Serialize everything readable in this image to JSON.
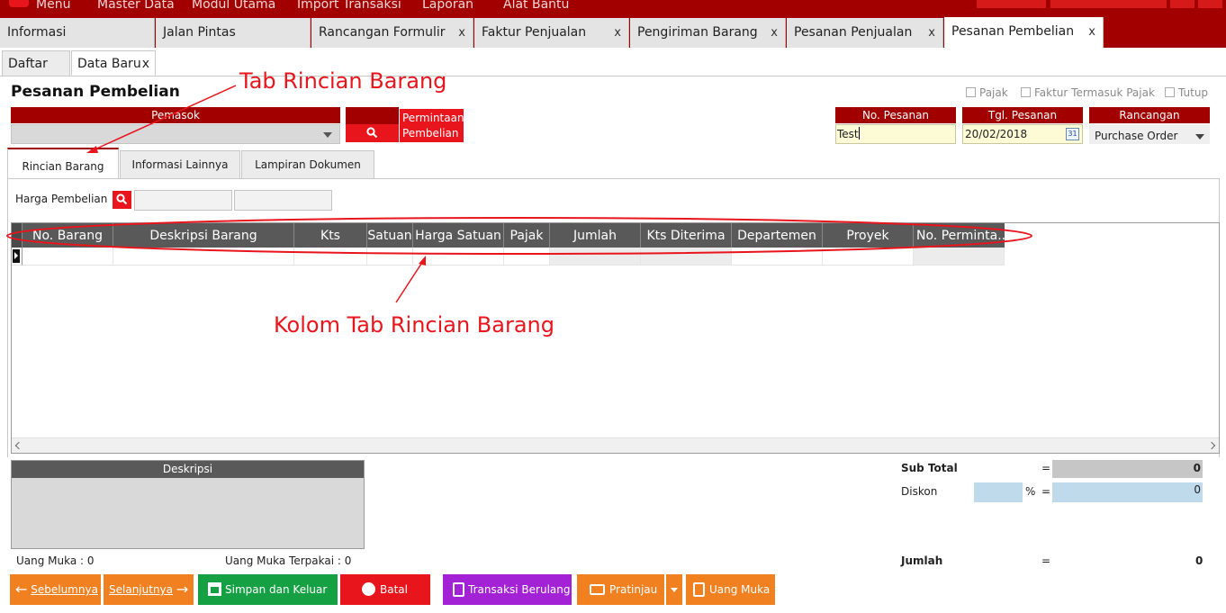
{
  "menu": {
    "items": [
      "Menu",
      "Master Data",
      "Modul Utama",
      "Import Transaksi",
      "Laporan",
      "Alat Bantu"
    ]
  },
  "module_tabs": [
    {
      "label": "Informasi",
      "closable": false
    },
    {
      "label": "Jalan Pintas",
      "closable": false
    },
    {
      "label": "Rancangan Formulir",
      "closable": true
    },
    {
      "label": "Faktur Penjualan",
      "closable": true
    },
    {
      "label": "Pengiriman Barang",
      "closable": true
    },
    {
      "label": "Pesanan Penjualan",
      "closable": true
    },
    {
      "label": "Pesanan Pembelian",
      "closable": true
    }
  ],
  "close_glyph": "x",
  "sub_tabs": {
    "list": "Daftar",
    "new": "Data Baru"
  },
  "form": {
    "title": "Pesanan Pembelian",
    "checkboxes": {
      "pajak": "Pajak",
      "faktur": "Faktur Termasuk Pajak",
      "tutup": "Tutup"
    },
    "pemasok_label": "Pemasok",
    "permintaan_label_1": "Permintaan",
    "permintaan_label_2": "Pembelian",
    "no_pesanan_label": "No. Pesanan",
    "no_pesanan_value": "Test",
    "tgl_pesanan_label": "Tgl. Pesanan",
    "tgl_pesanan_value": "20/02/2018",
    "calendar_day": "31",
    "rancangan_label": "Rancangan",
    "rancangan_value": "Purchase Order"
  },
  "inner_tabs": [
    "Rincian Barang",
    "Informasi Lainnya",
    "Lampiran Dokumen"
  ],
  "harga_pembelian_label": "Harga Pembelian",
  "grid": {
    "columns": [
      "No. Barang",
      "Deskripsi Barang",
      "Kts",
      "Satuan",
      "Harga Satuan",
      "Pajak",
      "Jumlah",
      "Kts Diterima",
      "Departemen",
      "Proyek",
      "No. Perminta..."
    ]
  },
  "annotations": {
    "tab_label": "Tab Rincian Barang",
    "column_label": "Kolom Tab Rincian Barang",
    "color": "#e8151d"
  },
  "deskripsi_label": "Deskripsi",
  "totals": {
    "subtotal_label": "Sub Total",
    "subtotal_value": "0",
    "diskon_label": "Diskon",
    "diskon_value": "0",
    "percent": "%",
    "equals": "=",
    "jumlah_label": "Jumlah",
    "jumlah_value": "0"
  },
  "uang_muka": "Uang Muka : 0",
  "uang_muka_terpakai": "Uang Muka Terpakai : 0",
  "buttons": {
    "prev": "Sebelumnya",
    "next": "Selanjutnya",
    "save": "Simpan dan Keluar",
    "cancel": "Batal",
    "recurring": "Transaksi Berulang",
    "preview": "Pratinjau",
    "advance": "Uang Muka"
  },
  "colors": {
    "brand": "#a20000",
    "accent_red": "#e8151d",
    "orange": "#f08020",
    "green": "#15a043",
    "purple": "#a322d6"
  }
}
